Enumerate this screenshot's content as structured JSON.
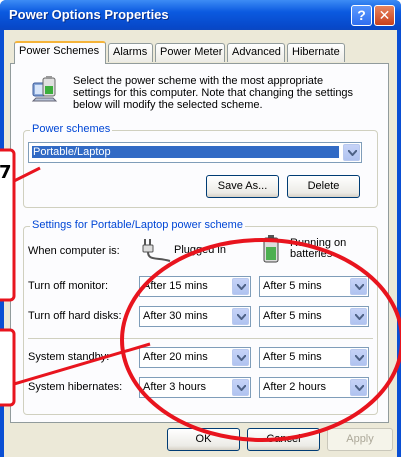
{
  "window": {
    "title": "Power Options Properties",
    "help_glyph": "?",
    "close_glyph": "✕"
  },
  "tabs": [
    {
      "label": "Power Schemes",
      "active": true
    },
    {
      "label": "Alarms"
    },
    {
      "label": "Power Meter"
    },
    {
      "label": "Advanced"
    },
    {
      "label": "Hibernate"
    }
  ],
  "intro_text": "Select the power scheme with the most appropriate settings for this computer. Note that changing the settings below will modify the selected scheme.",
  "power_schemes": {
    "group_title": "Power schemes",
    "selected": "Portable/Laptop",
    "save_as_label": "Save As...",
    "delete_label": "Delete"
  },
  "settings": {
    "group_title": "Settings for Portable/Laptop power scheme",
    "when_label": "When computer is:",
    "plugged_in_label": "Plugged in",
    "running_on_batteries_label": "Running on batteries",
    "rows": [
      {
        "label": "Turn off monitor:",
        "plugged": "After 15 mins",
        "battery": "After 5 mins"
      },
      {
        "label": "Turn off hard disks:",
        "plugged": "After 30 mins",
        "battery": "After 5 mins"
      },
      {
        "label": "System standby:",
        "plugged": "After 20 mins",
        "battery": "After 5 mins"
      },
      {
        "label": "System hibernates:",
        "plugged": "After 3 hours",
        "battery": "After 2 hours"
      }
    ]
  },
  "buttons": {
    "ok": "OK",
    "cancel": "Cancel",
    "apply": "Apply"
  },
  "annotation_color": "#e8141e",
  "icons": {
    "help": "help-icon",
    "close": "close-icon",
    "battery": "battery-laptop-icon",
    "plug": "power-plug-icon",
    "battery_small": "battery-icon",
    "dropdown": "chevron-down-icon"
  }
}
